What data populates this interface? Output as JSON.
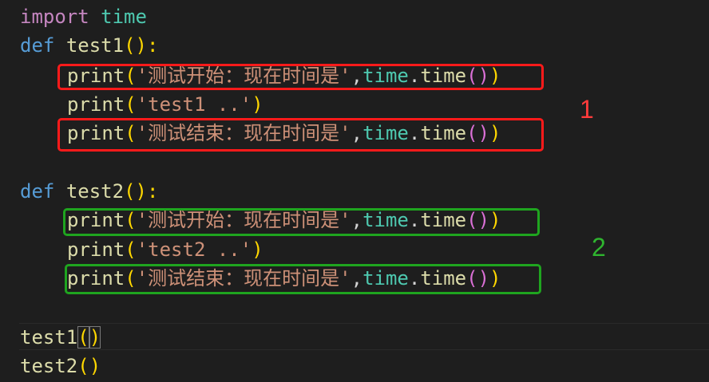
{
  "code": {
    "import_kw": "import",
    "import_mod": "time",
    "def_kw": "def",
    "func1": "test1",
    "func2": "test2",
    "parens_colon": "():",
    "indent": "    ",
    "print": "print",
    "time_mod": "time",
    "dot": ".",
    "time_fn": "time",
    "comma": ",",
    "open_paren": "(",
    "close_paren": ")",
    "str_start": "'测试开始：现在时间是'",
    "str_end": "'测试结束：现在时间是'",
    "str_test1": "'test1 ..'",
    "str_test2": "'test2 ..'",
    "call_test1": "test1",
    "call_test2": "test2"
  },
  "annotations": {
    "group1_label": "1",
    "group2_label": "2",
    "group1_color": "#ff1a1a",
    "group2_color": "#1fa51f"
  },
  "theme": {
    "background": "#1e1e1e",
    "keyword_import": "#c586c0",
    "keyword_def": "#569cd6",
    "module": "#4ec9b0",
    "function": "#dcdcaa",
    "string": "#ce9178",
    "bracket_level1": "#ffd700",
    "bracket_level2": "#da70d6"
  }
}
